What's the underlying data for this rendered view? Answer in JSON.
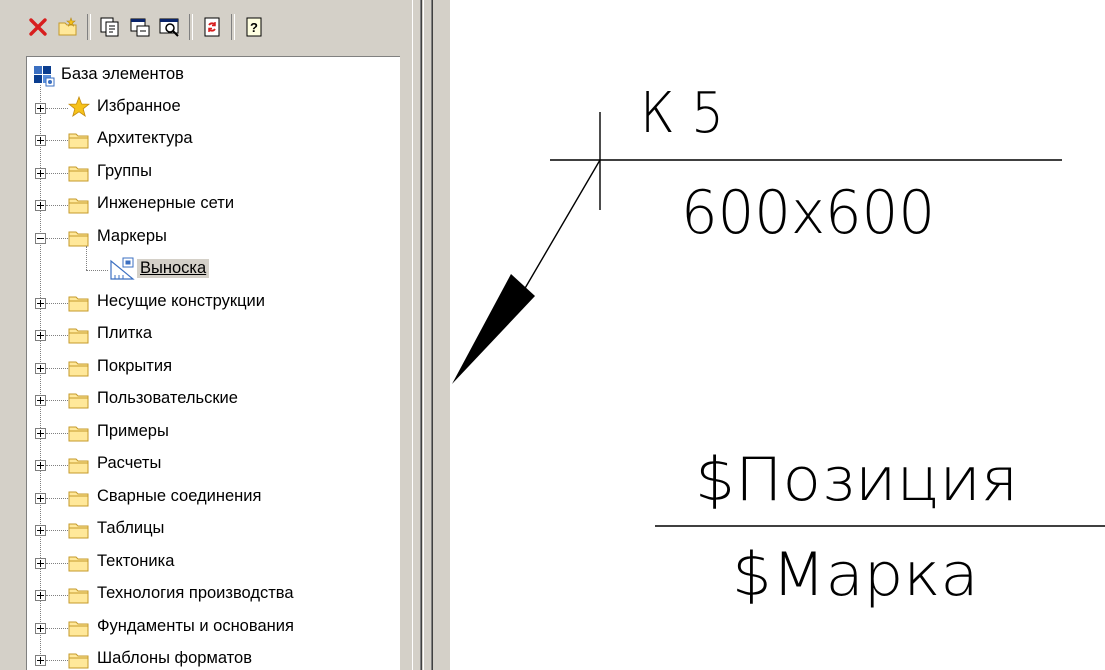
{
  "toolbar": {
    "buttons": [
      {
        "name": "delete-icon"
      },
      {
        "name": "new-folder-icon"
      },
      {
        "name": "properties-icon"
      },
      {
        "name": "insert-icon"
      },
      {
        "name": "preview-icon"
      },
      {
        "name": "refresh-icon"
      },
      {
        "name": "help-icon"
      }
    ]
  },
  "tree": {
    "root": "База элементов",
    "items": [
      {
        "label": "Избранное",
        "icon": "star-icon",
        "state": "collapsed"
      },
      {
        "label": "Архитектура",
        "icon": "folder-icon",
        "state": "collapsed"
      },
      {
        "label": "Группы",
        "icon": "folder-icon",
        "state": "collapsed"
      },
      {
        "label": "Инженерные сети",
        "icon": "folder-icon",
        "state": "collapsed"
      },
      {
        "label": "Маркеры",
        "icon": "folder-icon",
        "state": "expanded"
      },
      {
        "label": "Выноска",
        "icon": "leader-element-icon",
        "state": "selected",
        "child": true
      },
      {
        "label": "Несущие конструкции",
        "icon": "folder-icon",
        "state": "collapsed"
      },
      {
        "label": "Плитка",
        "icon": "folder-icon",
        "state": "collapsed"
      },
      {
        "label": "Покрытия",
        "icon": "folder-icon",
        "state": "collapsed"
      },
      {
        "label": "Пользовательские",
        "icon": "folder-icon",
        "state": "collapsed"
      },
      {
        "label": "Примеры",
        "icon": "folder-icon",
        "state": "collapsed"
      },
      {
        "label": "Расчеты",
        "icon": "folder-icon",
        "state": "collapsed"
      },
      {
        "label": "Сварные соединения",
        "icon": "folder-icon",
        "state": "collapsed"
      },
      {
        "label": "Таблицы",
        "icon": "folder-icon",
        "state": "collapsed"
      },
      {
        "label": "Тектоника",
        "icon": "folder-icon",
        "state": "collapsed"
      },
      {
        "label": "Технология производства",
        "icon": "folder-icon",
        "state": "collapsed"
      },
      {
        "label": "Фундаменты и основания",
        "icon": "folder-icon",
        "state": "collapsed"
      },
      {
        "label": "Шаблоны форматов",
        "icon": "folder-icon",
        "state": "collapsed"
      }
    ]
  },
  "drawing": {
    "leader_mark": "К 5",
    "leader_size": "600x600",
    "template_top": "$Позиция",
    "template_bottom": "$Марка"
  },
  "colors": {
    "panel_bg": "#d4d0c8",
    "folder_fill": "#ffe89a",
    "folder_stroke": "#c59a2a",
    "delete_red": "#d81e1e",
    "star_yellow": "#f6c21a"
  }
}
